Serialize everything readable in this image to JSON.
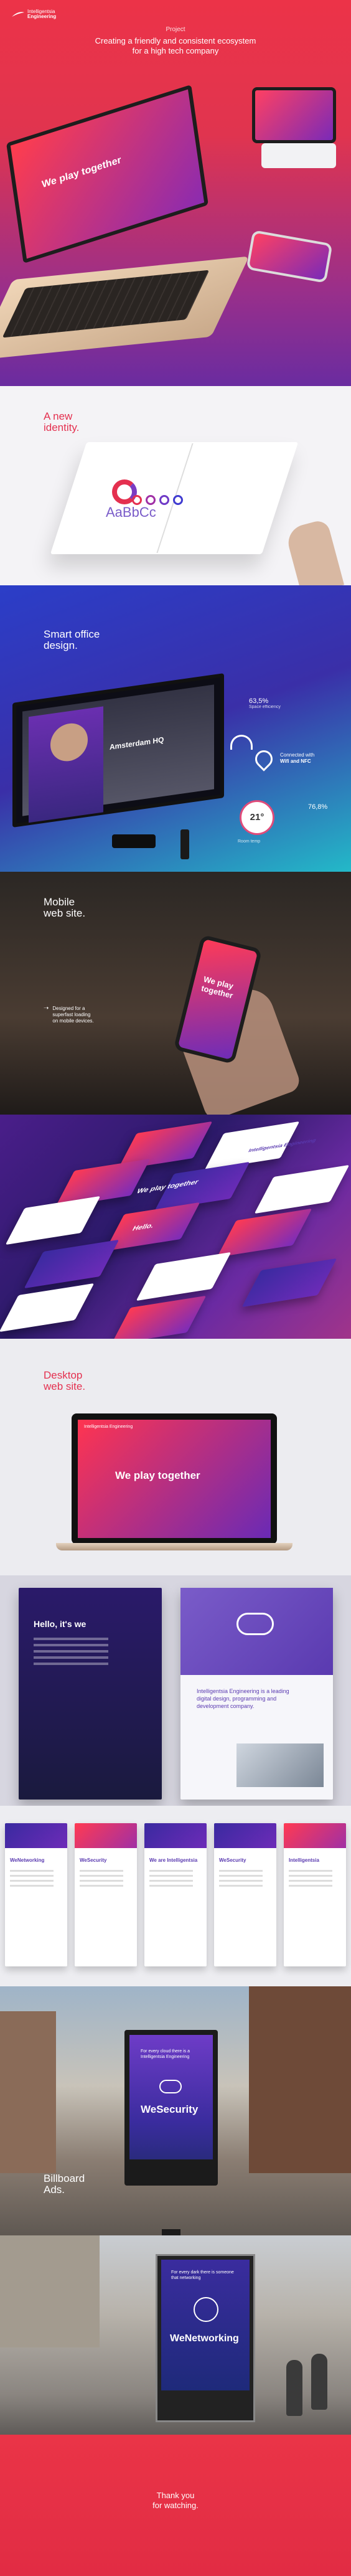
{
  "hero": {
    "kicker": "Project",
    "title_line1": "Creating a friendly and consistent ecosystem",
    "title_line2": "for a high tech company",
    "logo_line1": "Intelligentsia",
    "logo_line2": "Engineering",
    "laptop_headline": "We play together"
  },
  "identity": {
    "title_line1": "A new",
    "title_line2": "identity.",
    "sample_type": "AaBbCc"
  },
  "office": {
    "title_line1": "Smart office",
    "title_line2": "design.",
    "temperature": "21°",
    "temp_label": "Room temp",
    "humidity": "76,8%",
    "efficiency": "63,5%",
    "efficiency_label": "Space efficiency",
    "connected_line1": "Connected with",
    "connected_line2": "Wifi and NFC",
    "room_name": "Amsterdam HQ"
  },
  "mobile": {
    "title_line1": "Mobile",
    "title_line2": "web site.",
    "note_line1": "Designed for a",
    "note_line2": "superfast loading",
    "note_line3": "on mobile devices.",
    "phone_text_line1": "We play",
    "phone_text_line2": "together"
  },
  "cards": {
    "c1": "We play together",
    "c2": "Hello.",
    "c3": "Intelligentsia Engineering"
  },
  "desktop": {
    "title_line1": "Desktop",
    "title_line2": "web site.",
    "headline": "We play together",
    "nav_brand": "Intelligentsia Engineering"
  },
  "pages": {
    "left_title": "Hello, it's we",
    "right_text": "Intelligentsia Engineering is a leading digital design, programming and development company."
  },
  "screens": {
    "s1": "WeNetworking",
    "s2": "WeSecurity",
    "s3": "We are Intelligentsia",
    "s4": "WeSecurity",
    "s5": "Intelligentsia"
  },
  "billboard": {
    "title_line1": "Billboard",
    "title_line2": "Ads.",
    "small": "For every cloud there is a Intelligentsia Engineering",
    "brand": "WeSecurity"
  },
  "busstop": {
    "small": "For every dark there is someone that networking",
    "brand": "WeNetworking"
  },
  "thanks": {
    "line1": "Thank you",
    "line2": "for watching."
  }
}
